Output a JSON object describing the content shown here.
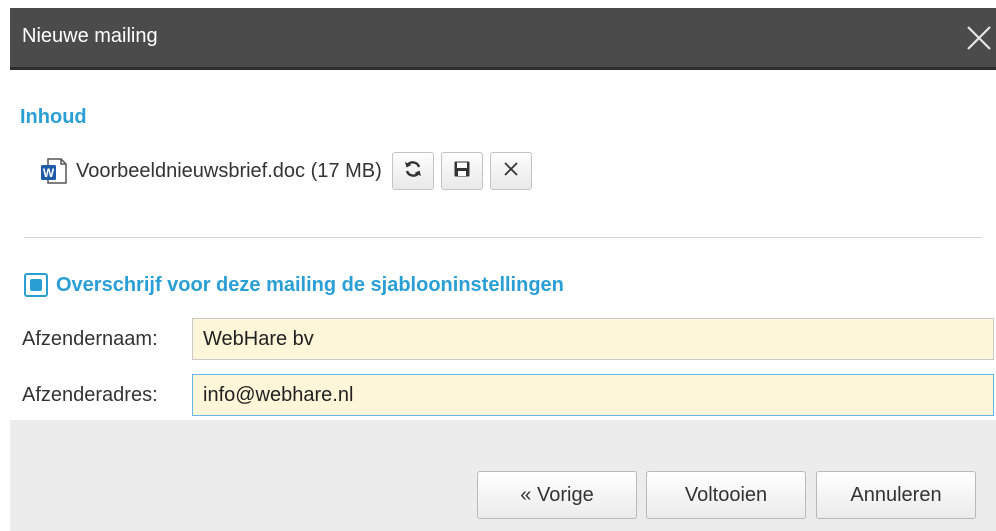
{
  "dialog": {
    "title": "Nieuwe mailing",
    "close_icon": "close-icon"
  },
  "content": {
    "section_title": "Inhoud",
    "file": {
      "icon": "word-document-icon",
      "name": "Voorbeeldnieuwsbrief.doc (17 MB)",
      "actions": [
        "refresh-icon",
        "save-icon",
        "close-icon"
      ]
    }
  },
  "override": {
    "checked": true,
    "label": "Overschrijf voor deze mailing de sjablooninstellingen"
  },
  "fields": {
    "sender_name": {
      "label": "Afzendernaam:",
      "value": "WebHare bv"
    },
    "sender_address": {
      "label": "Afzenderadres:",
      "value": "info@webhare.nl"
    }
  },
  "footer": {
    "previous_label": "« Vorige",
    "finish_label": "Voltooien",
    "cancel_label": "Annuleren"
  },
  "colors": {
    "accent": "#2a9fd6",
    "titlebar": "#4b4b4b",
    "input_bg": "#fdf6d8",
    "footer_bg": "#ececec"
  }
}
